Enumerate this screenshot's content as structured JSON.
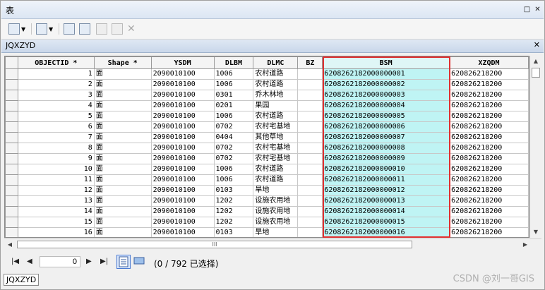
{
  "window": {
    "title": "表",
    "pin_icon": "pin-icon",
    "close_icon": "close-icon"
  },
  "toolbar": {
    "buttons": [
      {
        "name": "table-options-button",
        "icon": "table-options-icon"
      },
      {
        "name": "related-tables-button",
        "icon": "related-tables-icon"
      },
      {
        "name": "select-by-attributes-button",
        "icon": "select-by-attributes-icon"
      },
      {
        "name": "switch-selection-button",
        "icon": "switch-selection-icon"
      },
      {
        "name": "clear-selection-button",
        "icon": "clear-selection-icon"
      },
      {
        "name": "zoom-to-selected-button",
        "icon": "zoom-to-selected-icon"
      },
      {
        "name": "delete-selected-button",
        "icon": "delete-icon"
      }
    ]
  },
  "tab": {
    "name": "JQXZYD"
  },
  "table": {
    "columns": [
      "OBJECTID *",
      "Shape *",
      "YSDM",
      "DLBM",
      "DLMC",
      "BZ",
      "BSM",
      "XZQDM"
    ],
    "rows": [
      [
        "1",
        "面",
        "2090010100",
        "1006",
        "农村道路",
        "",
        "6208262182000000001",
        "620826218200"
      ],
      [
        "2",
        "面",
        "2090010100",
        "1006",
        "农村道路",
        "",
        "6208262182000000002",
        "620826218200"
      ],
      [
        "3",
        "面",
        "2090010100",
        "0301",
        "乔木林地",
        "",
        "6208262182000000003",
        "620826218200"
      ],
      [
        "4",
        "面",
        "2090010100",
        "0201",
        "果园",
        "",
        "6208262182000000004",
        "620826218200"
      ],
      [
        "5",
        "面",
        "2090010100",
        "1006",
        "农村道路",
        "",
        "6208262182000000005",
        "620826218200"
      ],
      [
        "6",
        "面",
        "2090010100",
        "0702",
        "农村宅基地",
        "",
        "6208262182000000006",
        "620826218200"
      ],
      [
        "7",
        "面",
        "2090010100",
        "0404",
        "其他草地",
        "",
        "6208262182000000007",
        "620826218200"
      ],
      [
        "8",
        "面",
        "2090010100",
        "0702",
        "农村宅基地",
        "",
        "6208262182000000008",
        "620826218200"
      ],
      [
        "9",
        "面",
        "2090010100",
        "0702",
        "农村宅基地",
        "",
        "6208262182000000009",
        "620826218200"
      ],
      [
        "10",
        "面",
        "2090010100",
        "1006",
        "农村道路",
        "",
        "6208262182000000010",
        "620826218200"
      ],
      [
        "11",
        "面",
        "2090010100",
        "1006",
        "农村道路",
        "",
        "6208262182000000011",
        "620826218200"
      ],
      [
        "12",
        "面",
        "2090010100",
        "0103",
        "旱地",
        "",
        "6208262182000000012",
        "620826218200"
      ],
      [
        "13",
        "面",
        "2090010100",
        "1202",
        "设施农用地",
        "",
        "6208262182000000013",
        "620826218200"
      ],
      [
        "14",
        "面",
        "2090010100",
        "1202",
        "设施农用地",
        "",
        "6208262182000000014",
        "620826218200"
      ],
      [
        "15",
        "面",
        "2090010100",
        "1202",
        "设施农用地",
        "",
        "6208262182000000015",
        "620826218200"
      ],
      [
        "16",
        "面",
        "2090010100",
        "0103",
        "旱地",
        "",
        "6208262182000000016",
        "620826218200"
      ]
    ]
  },
  "hscroll": {
    "thumb_label": "III"
  },
  "statusbar": {
    "record_value": "0",
    "selection_text": "(0 / 792 已选择)"
  },
  "bottom_tab": "JQXZYD",
  "watermark": "CSDN @刘一哥GIS",
  "colors": {
    "highlight": "#e03030",
    "bsm_fill": "#bff4f4"
  }
}
